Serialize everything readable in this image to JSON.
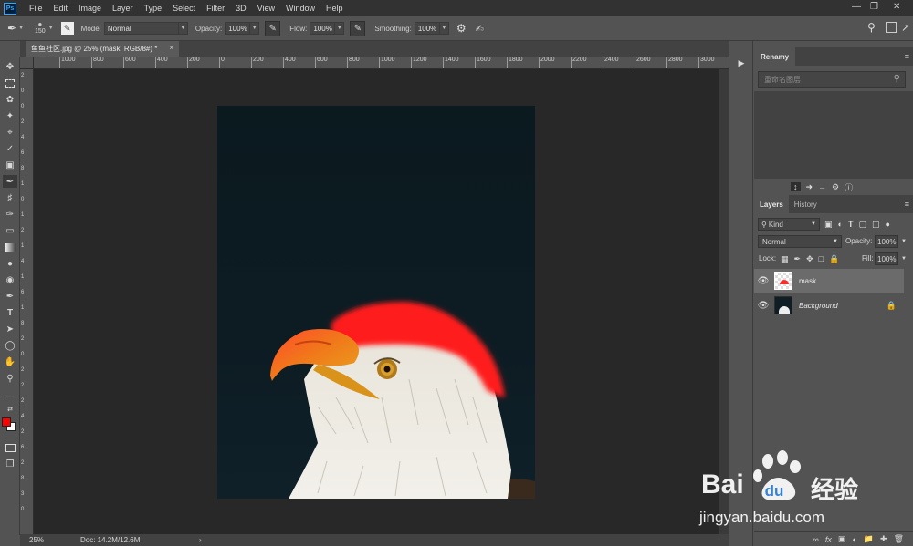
{
  "app": {
    "logo_text": "Ps"
  },
  "menubar": {
    "items": [
      "File",
      "Edit",
      "Image",
      "Layer",
      "Type",
      "Select",
      "Filter",
      "3D",
      "View",
      "Window",
      "Help"
    ]
  },
  "options_bar": {
    "brush_size": "150",
    "mode_label": "Mode:",
    "mode_value": "Normal",
    "opacity_label": "Opacity:",
    "opacity_value": "100%",
    "flow_label": "Flow:",
    "flow_value": "100%",
    "smoothing_label": "Smoothing:",
    "smoothing_value": "100%"
  },
  "document": {
    "tab_title": "鱼鱼社区.jpg @ 25% (mask, RGB/8#) *",
    "close_glyph": "×"
  },
  "rulers": {
    "horizontal": [
      "1000",
      "800",
      "600",
      "400",
      "200",
      "0",
      "200",
      "400",
      "600",
      "800",
      "1000",
      "1200",
      "1400",
      "1600",
      "1800",
      "2000",
      "2200",
      "2400",
      "2600",
      "2800",
      "3000"
    ],
    "vertical": [
      "2",
      "0",
      "0",
      "2",
      "4",
      "6",
      "8",
      "1",
      "0",
      "1",
      "2",
      "1",
      "4",
      "1",
      "6",
      "1",
      "8",
      "2",
      "0",
      "2",
      "2",
      "2",
      "4",
      "2",
      "6",
      "2",
      "8",
      "3",
      "0"
    ]
  },
  "status_bar": {
    "zoom": "25%",
    "doc_info": "Doc: 14.2M/12.6M",
    "arrow": "›"
  },
  "renamy_panel": {
    "title": "Renamy",
    "search_placeholder": "重命名图层"
  },
  "layers_panel": {
    "tab_layers": "Layers",
    "tab_history": "History",
    "filter_label": "Kind",
    "blend_mode": "Normal",
    "opacity_label": "Opacity:",
    "opacity_value": "100%",
    "lock_label": "Lock:",
    "fill_label": "Fill:",
    "fill_value": "100%",
    "layers": [
      {
        "name": "mask",
        "selected": true
      },
      {
        "name": "Background",
        "selected": false
      }
    ]
  },
  "watermark": {
    "brand_left": "Bai",
    "brand_right": "经验",
    "url": "jingyan.baidu.com"
  },
  "colors": {
    "foreground": "#ff0000",
    "background": "#ffffff"
  }
}
